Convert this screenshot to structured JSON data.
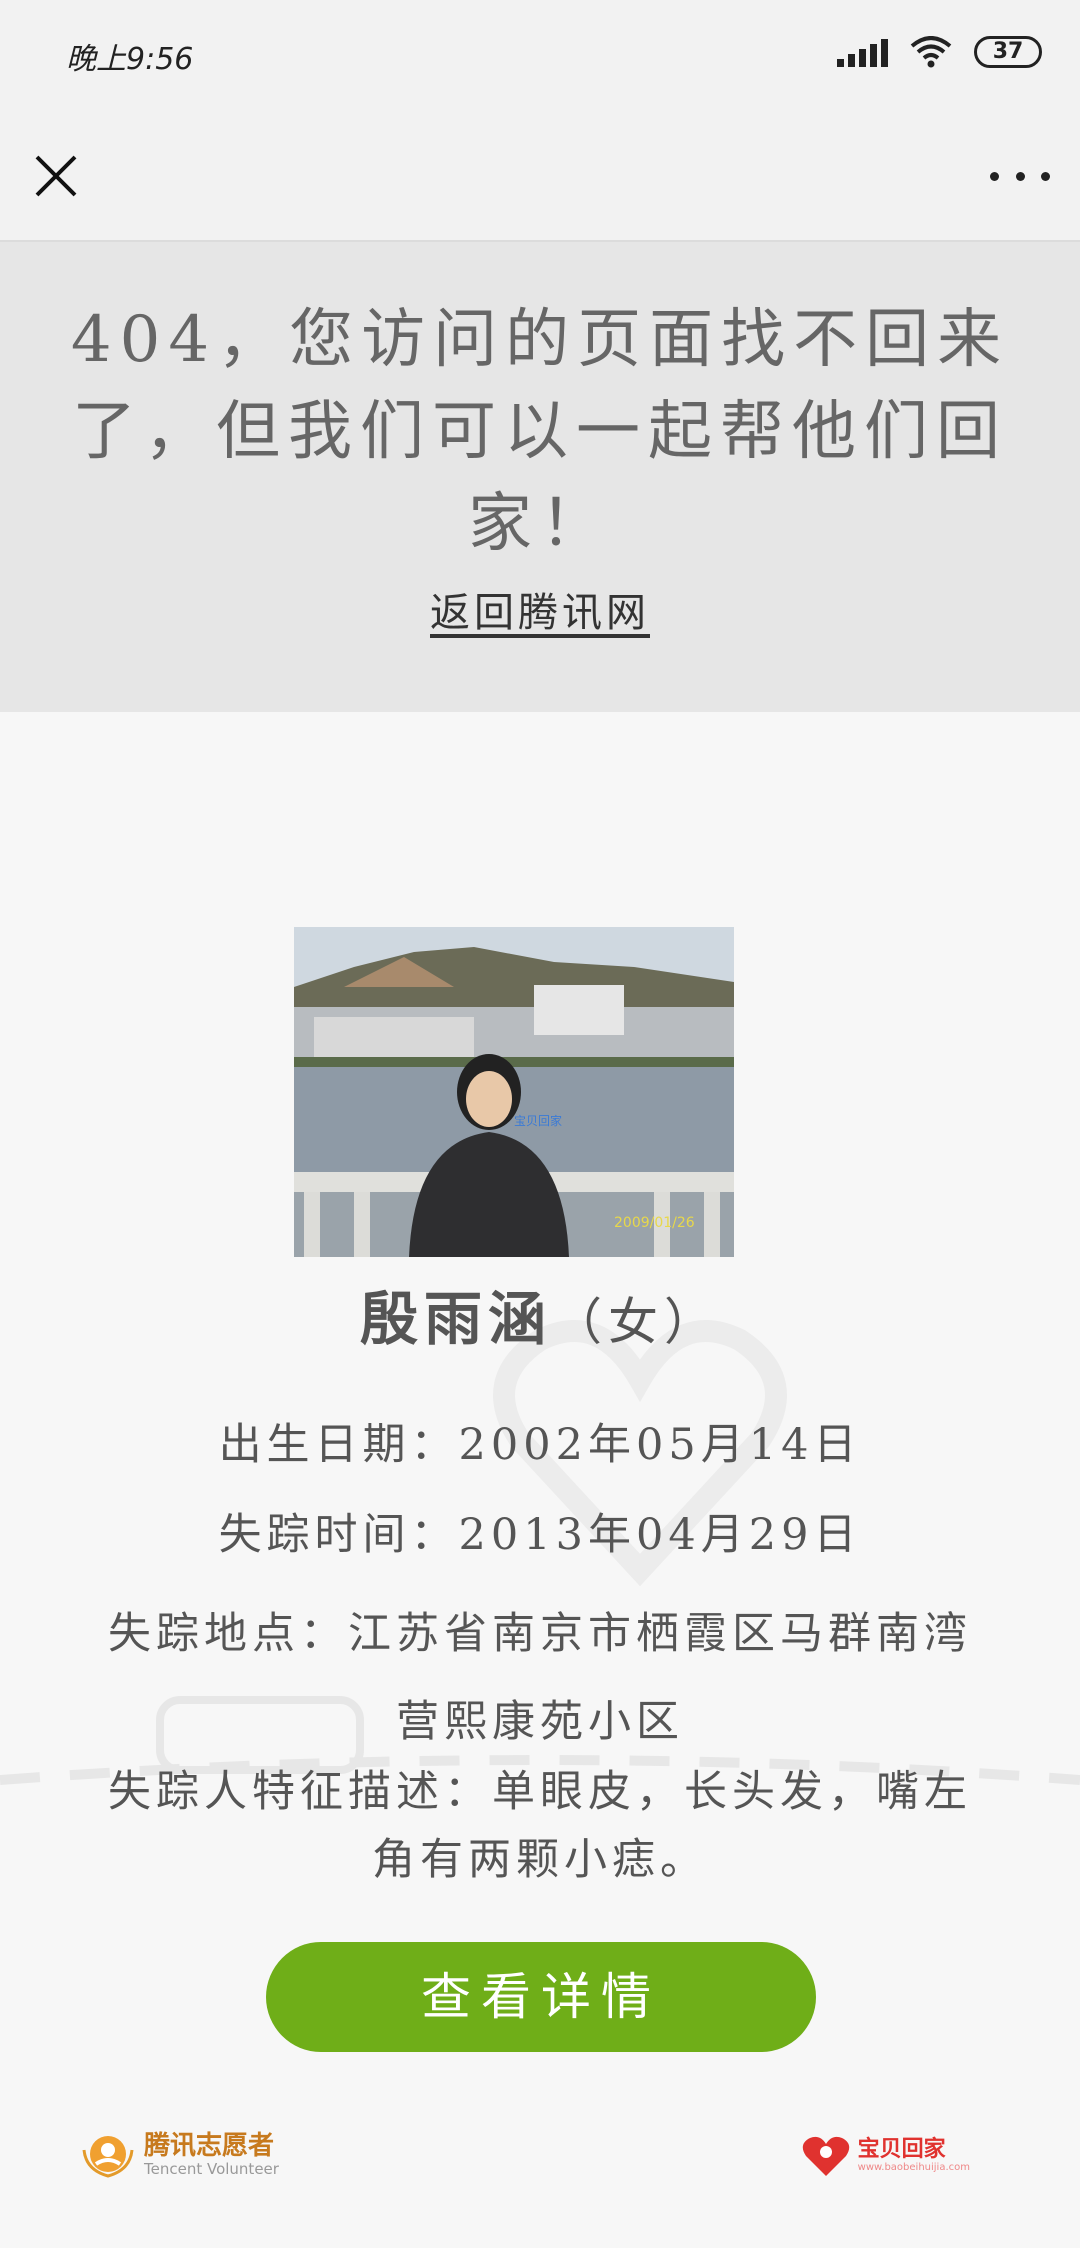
{
  "status_bar": {
    "time": "晚上9:56",
    "battery": "37"
  },
  "banner": {
    "title": "404，您访问的页面找不回来了，但我们可以一起帮他们回家！",
    "link": "返回腾讯网"
  },
  "person": {
    "photo_caption": "宝贝回家",
    "photo_date": "2009/01/26",
    "name": "殷雨涵",
    "gender": "（女）",
    "birth": "出生日期：2002年05月14日",
    "missing_time": "失踪时间：2013年04月29日",
    "missing_place": "失踪地点：江苏省南京市栖霞区马群南湾营熙康苑小区",
    "features": "失踪人特征描述：单眼皮，长头发，嘴左角有两颗小痣。"
  },
  "button": {
    "detail": "查看详情"
  },
  "footer": {
    "left_logo": {
      "name": "腾讯志愿者",
      "sub": "Tencent Volunteer"
    },
    "right_logo": {
      "name": "宝贝回家",
      "sub": "www.baobeihuijia.com"
    }
  },
  "colors": {
    "accent": "#6fae18",
    "banner_bg": "#e6e6e6"
  },
  "icons": [
    "close-icon",
    "more-icon",
    "signal-icon",
    "wifi-icon",
    "battery-icon",
    "heart-icon"
  ]
}
